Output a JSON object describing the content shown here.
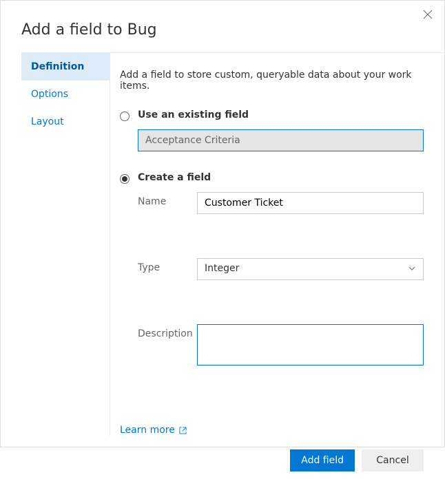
{
  "dialog": {
    "title": "Add a field to Bug"
  },
  "tabs": {
    "items": [
      {
        "label": "Definition",
        "active": true
      },
      {
        "label": "Options",
        "active": false
      },
      {
        "label": "Layout",
        "active": false
      }
    ]
  },
  "panel": {
    "intro": "Add a field to store custom, queryable data about your work items."
  },
  "existing": {
    "radio_label": "Use an existing field",
    "value": "Acceptance Criteria"
  },
  "create": {
    "radio_label": "Create a field",
    "name_label": "Name",
    "name_value": "Customer Ticket",
    "type_label": "Type",
    "type_value": "Integer",
    "desc_label": "Description",
    "desc_value": ""
  },
  "learn_more": "Learn more",
  "buttons": {
    "primary": "Add field",
    "cancel": "Cancel"
  }
}
